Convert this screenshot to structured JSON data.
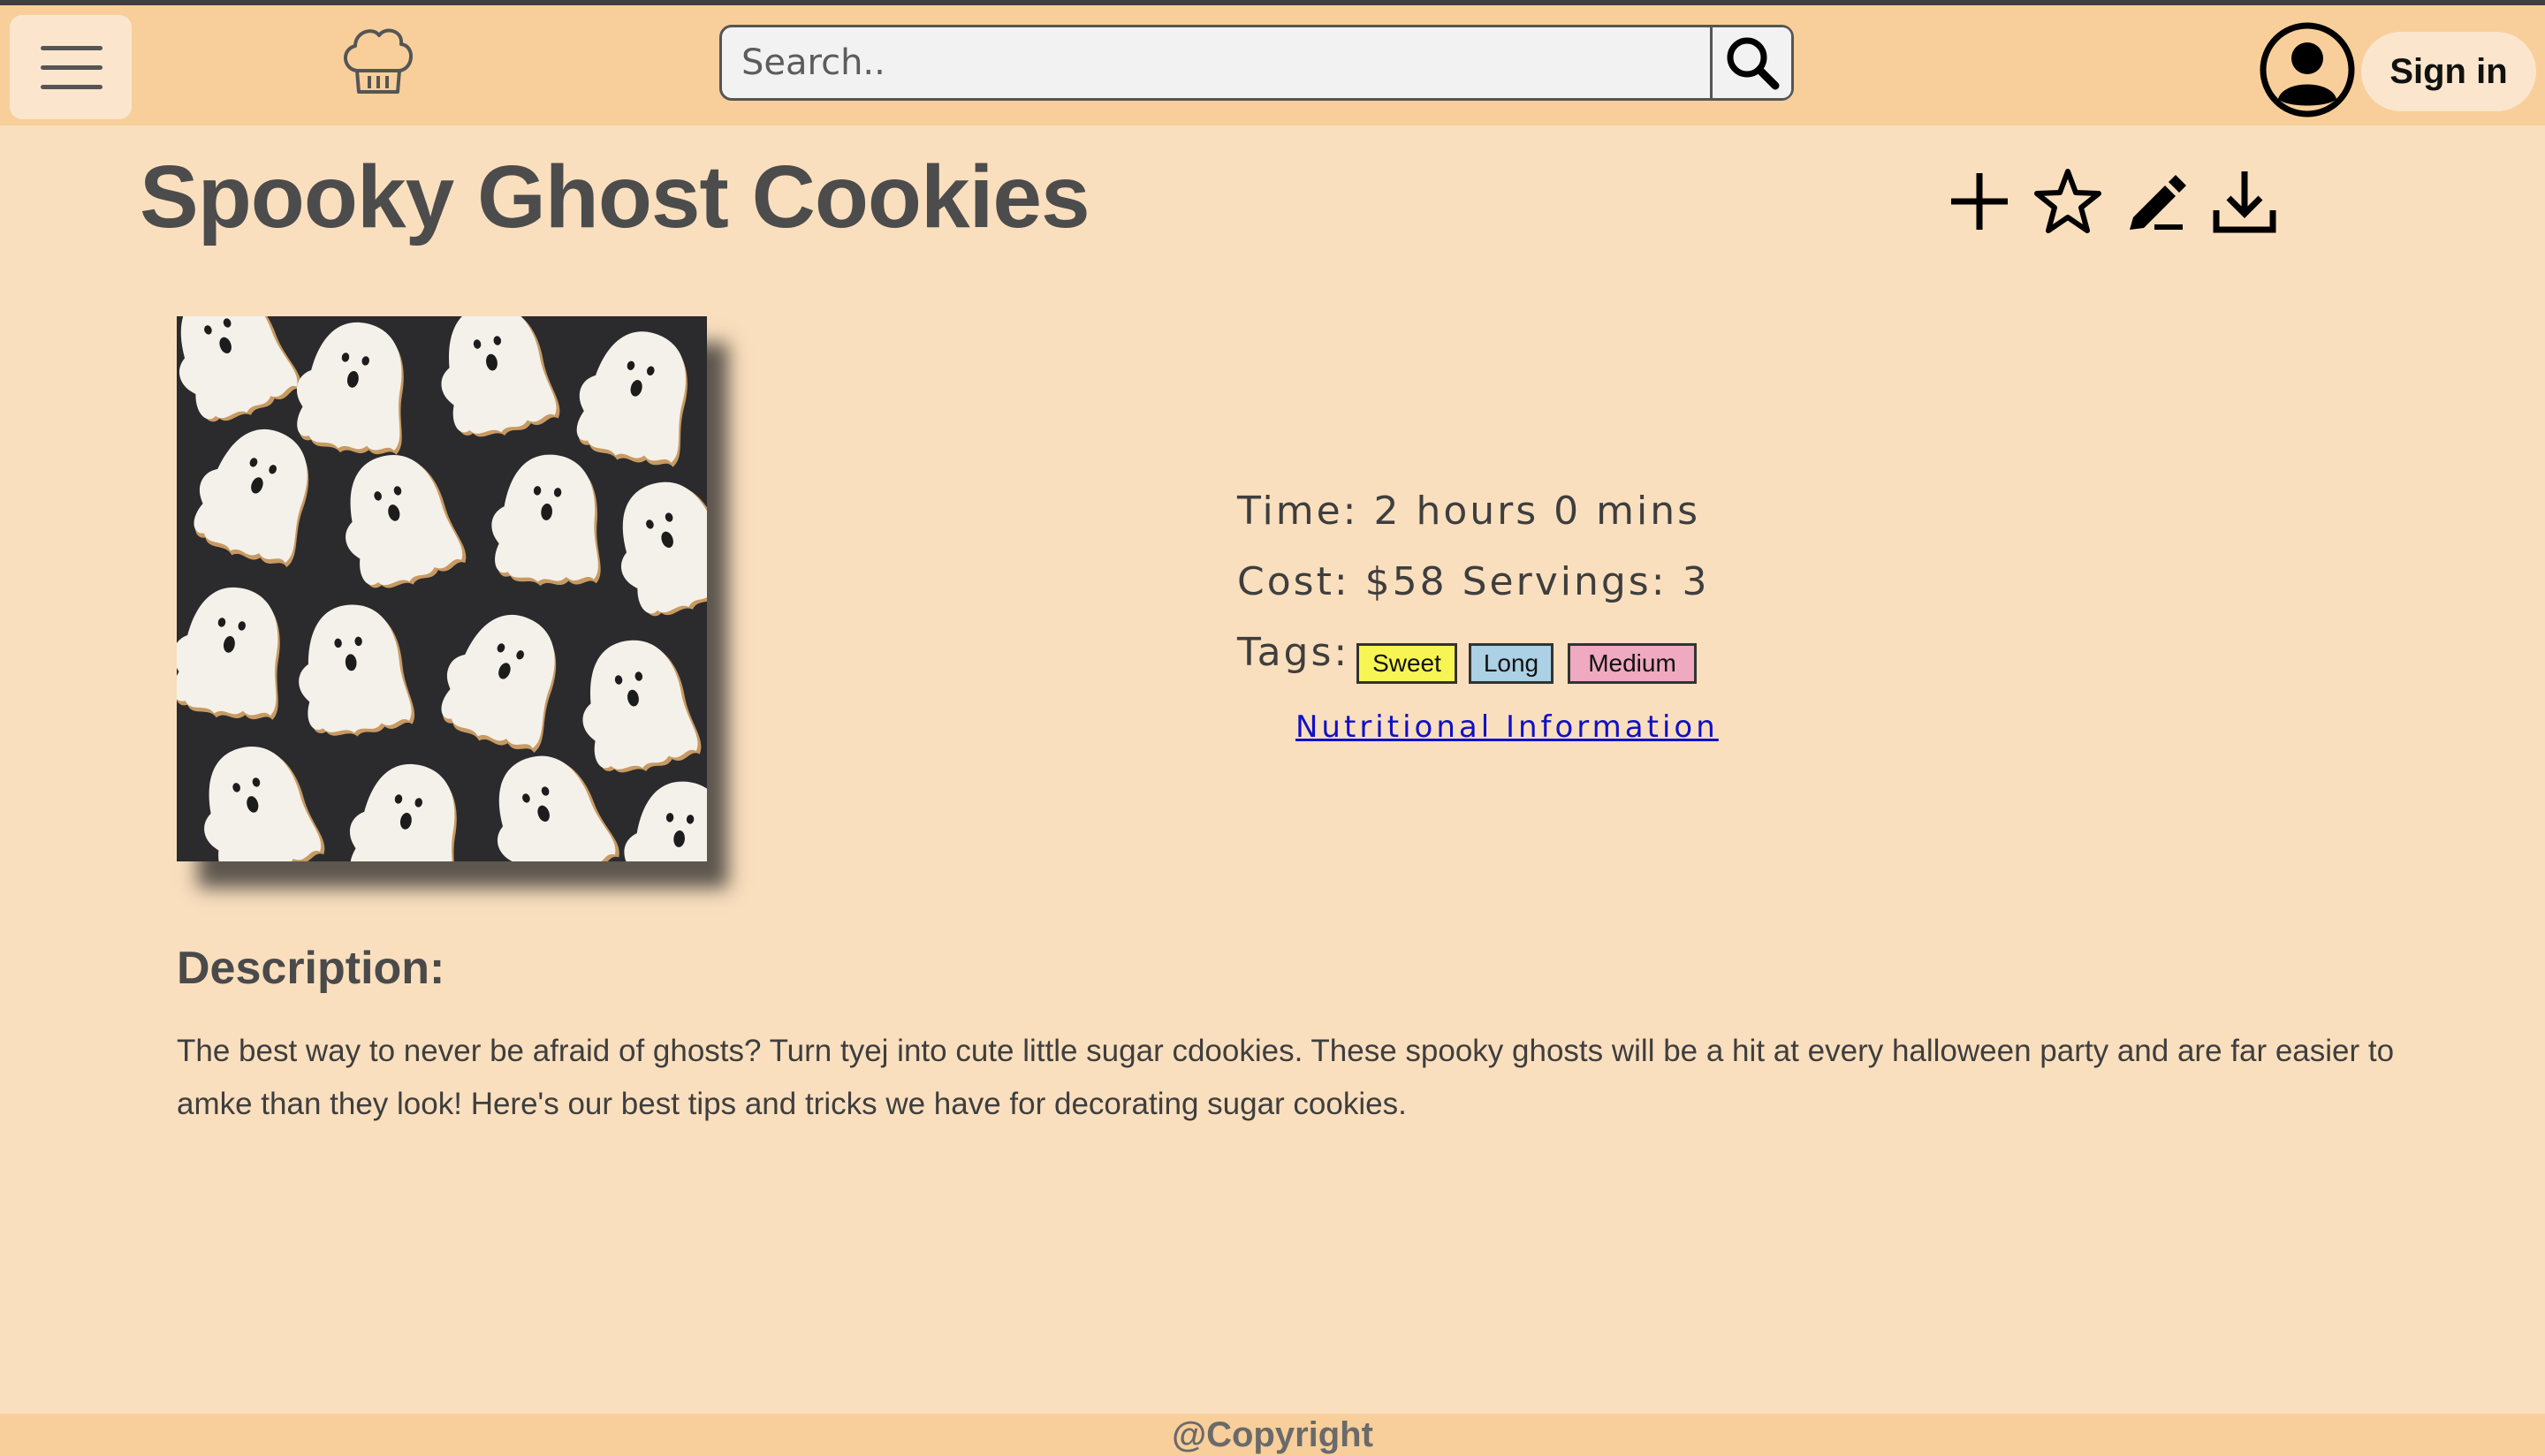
{
  "header": {
    "search_placeholder": "Search..",
    "sign_in_label": "Sign in"
  },
  "icons": {
    "menu": "hamburger-menu-icon",
    "logo": "chef-hat-icon",
    "search": "search-icon",
    "profile": "user-circle-icon",
    "actions": [
      "plus-icon",
      "star-icon",
      "pencil-icon",
      "download-icon"
    ]
  },
  "recipe": {
    "title": "Spooky Ghost Cookies",
    "time_text": "Time: 2 hours 0 mins",
    "cost_servings_text": "Cost: $58 Servings: 3",
    "tags_label": "Tags:",
    "tags": [
      {
        "label": "Sweet",
        "color": "#f7f553"
      },
      {
        "label": "Long",
        "color": "#acd0e4"
      },
      {
        "label": "Medium",
        "color": "#efa9c1"
      }
    ],
    "nutrition_link": "Nutritional Information",
    "description_heading": "Description:",
    "description": "The best way to never be afraid of ghosts? Turn tyej into cute little sugar cdookies. These spooky ghosts will be a hit at every halloween party and are far easier to amke than they look! Here's our best tips and tricks we have for decorating sugar cookies."
  },
  "footer": {
    "text": "@Copyright"
  },
  "colors": {
    "navbar": "#f8cf9a",
    "page_background": "#fadfbe",
    "link": "#1010c8"
  }
}
